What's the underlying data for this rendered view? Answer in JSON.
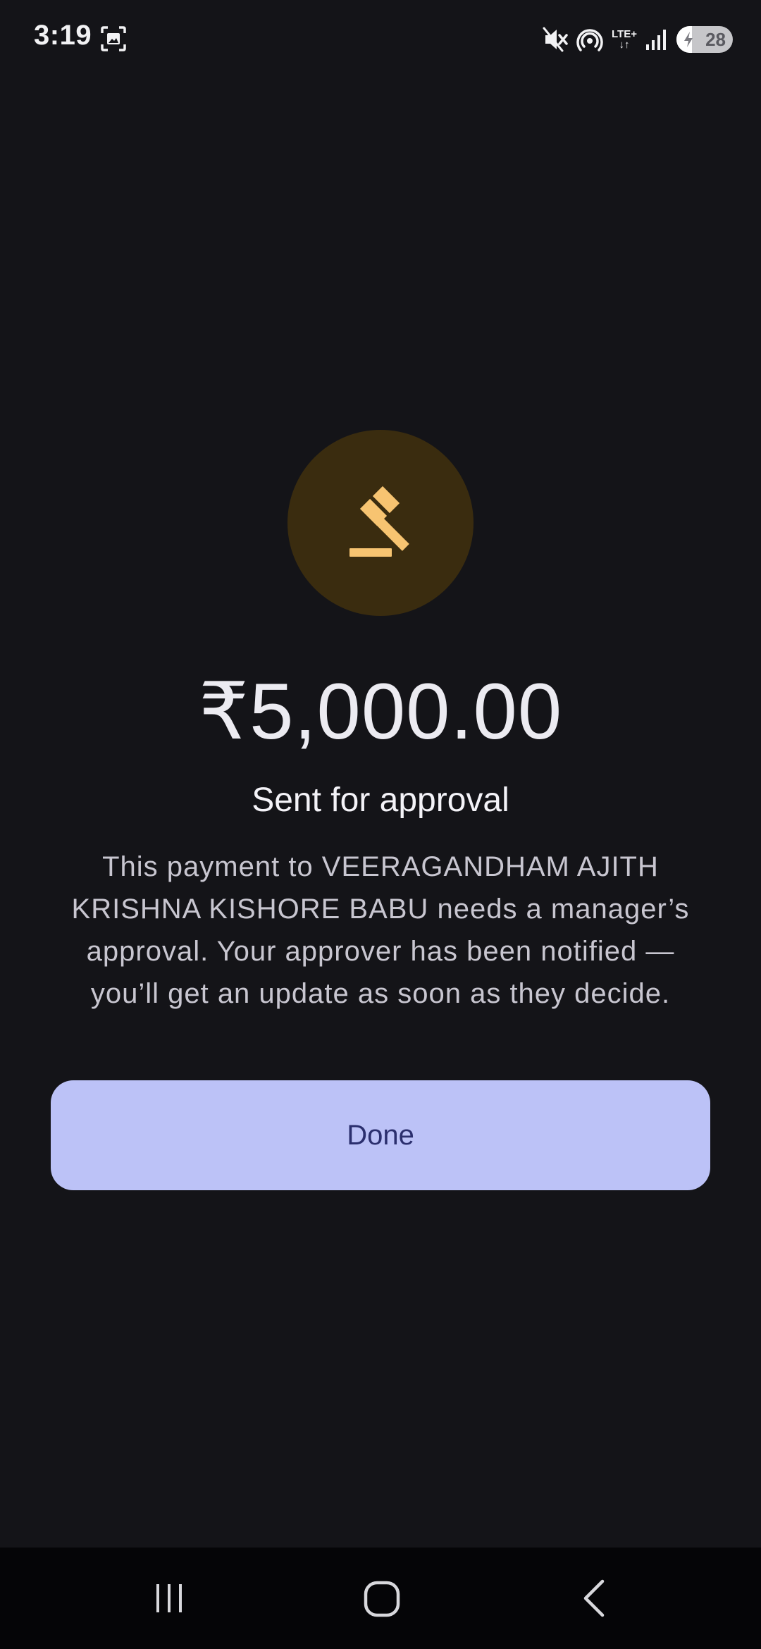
{
  "status_bar": {
    "time": "3:19",
    "screenshot_icon": "screenshot-icon",
    "mute_icon": "mute-icon",
    "hotspot_icon": "hotspot-icon",
    "network_type": "LTE+",
    "signal_icon": "signal-icon",
    "battery_level": "28",
    "battery_fraction": 0.28
  },
  "main": {
    "icon": "gavel-icon",
    "amount": "₹5,000.00",
    "title": "Sent for approval",
    "description": "This payment to VEERAGANDHAM AJITH KRISHNA KISHORE BABU needs a manager’s approval. Your approver has been notified — you’ll get an update as soon as they decide.",
    "done_label": "Done"
  },
  "nav_bar": {
    "recents": "recents-icon",
    "home": "home-icon",
    "back": "back-icon"
  },
  "colors": {
    "background": "#141418",
    "icon_circle": "#3a2c0f",
    "icon_accent": "#f7c471",
    "button_bg": "#bcc2f7",
    "button_text": "#2b2f6e"
  }
}
